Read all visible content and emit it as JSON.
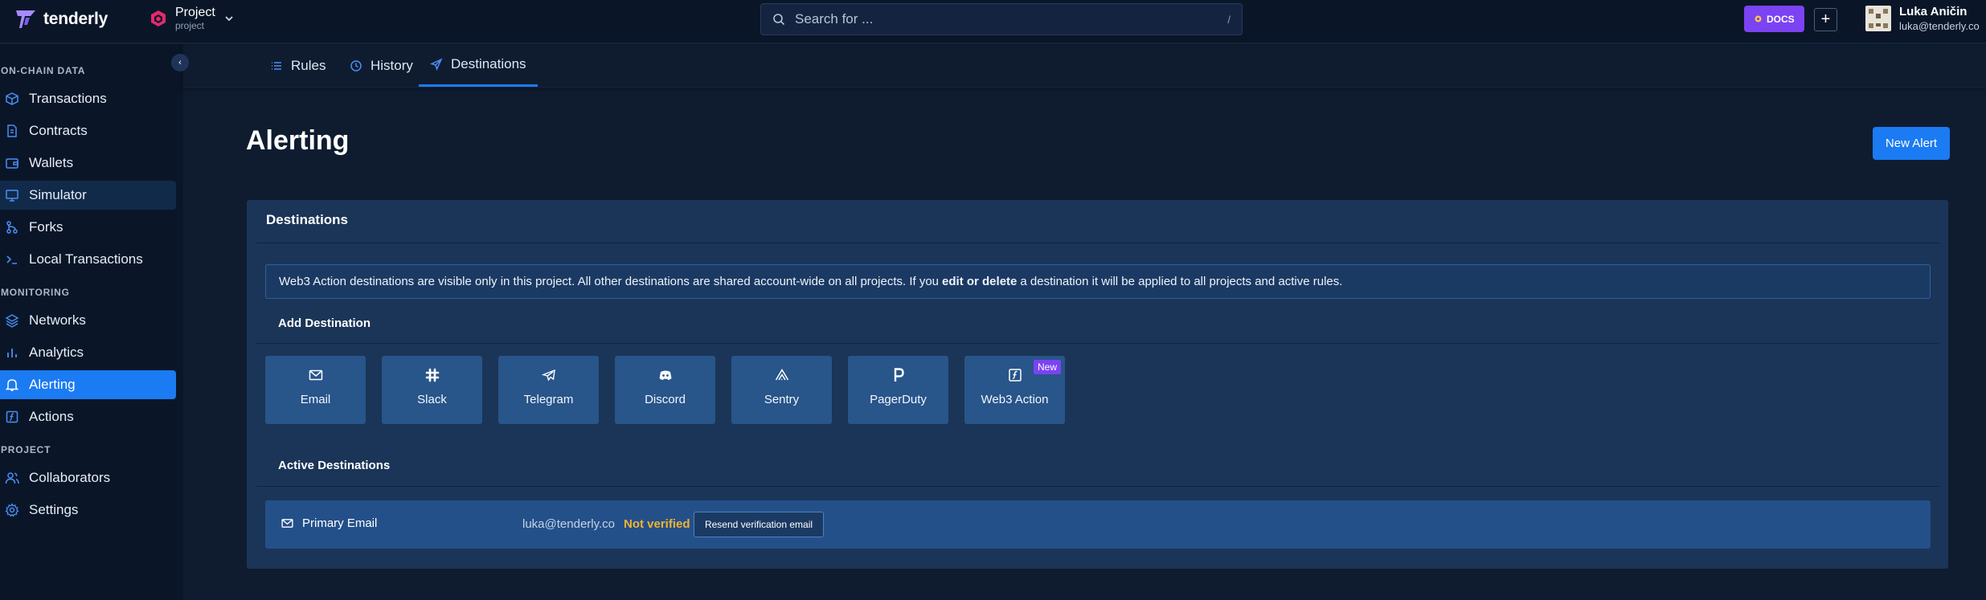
{
  "brand": {
    "name": "tenderly"
  },
  "project": {
    "name": "Project",
    "slug": "project"
  },
  "search": {
    "placeholder": "Search for ...",
    "shortcut": "/"
  },
  "header": {
    "docs_label": "DOCS",
    "add_label": "+"
  },
  "user": {
    "name": "Luka Aničin",
    "email": "luka@tenderly.co"
  },
  "sidebar": {
    "collapse_label": "‹",
    "sections": [
      {
        "label": "ON-CHAIN DATA"
      },
      {
        "label": "MONITORING"
      },
      {
        "label": "PROJECT"
      }
    ],
    "items": [
      {
        "label": "Transactions",
        "icon": "cube-icon"
      },
      {
        "label": "Contracts",
        "icon": "document-icon"
      },
      {
        "label": "Wallets",
        "icon": "wallet-icon"
      },
      {
        "label": "Simulator",
        "icon": "monitor-icon"
      },
      {
        "label": "Forks",
        "icon": "fork-icon"
      },
      {
        "label": "Local Transactions",
        "icon": "terminal-icon"
      },
      {
        "label": "Networks",
        "icon": "layers-icon"
      },
      {
        "label": "Analytics",
        "icon": "bar-chart-icon"
      },
      {
        "label": "Alerting",
        "icon": "bell-icon"
      },
      {
        "label": "Actions",
        "icon": "function-icon"
      },
      {
        "label": "Collaborators",
        "icon": "users-icon"
      },
      {
        "label": "Settings",
        "icon": "gear-icon"
      }
    ]
  },
  "tabs": [
    {
      "label": "Rules",
      "icon": "list-icon"
    },
    {
      "label": "History",
      "icon": "clock-icon"
    },
    {
      "label": "Destinations",
      "icon": "send-icon"
    }
  ],
  "main": {
    "title": "Alerting",
    "new_alert_label": "New Alert",
    "card_title": "Destinations",
    "info": {
      "prefix": "Web3 Action destinations are visible only in this project. All other destinations are shared account-wide on all projects. If you",
      "bold": "edit or delete",
      "suffix": "a destination it will be applied to all projects and active rules."
    },
    "add_heading": "Add Destination",
    "destination_types": [
      {
        "label": "Email",
        "icon": "mail-icon"
      },
      {
        "label": "Slack",
        "icon": "slack-icon"
      },
      {
        "label": "Telegram",
        "icon": "telegram-icon"
      },
      {
        "label": "Discord",
        "icon": "discord-icon"
      },
      {
        "label": "Sentry",
        "icon": "sentry-icon"
      },
      {
        "label": "PagerDuty",
        "icon": "pagerduty-icon"
      },
      {
        "label": "Web3 Action",
        "icon": "function-icon",
        "badge": "New"
      }
    ],
    "active_heading": "Active Destinations",
    "active_destinations": [
      {
        "name": "Primary Email",
        "email": "luka@tenderly.co",
        "status": "Not verified",
        "action_label": "Resend verification email"
      }
    ]
  },
  "colors": {
    "accent": "#1b7bf2",
    "purple": "#7b43f2",
    "warning": "#f0b430",
    "background": "#0f1c30",
    "sidebar": "#0a1628",
    "card": "#1a3557"
  }
}
